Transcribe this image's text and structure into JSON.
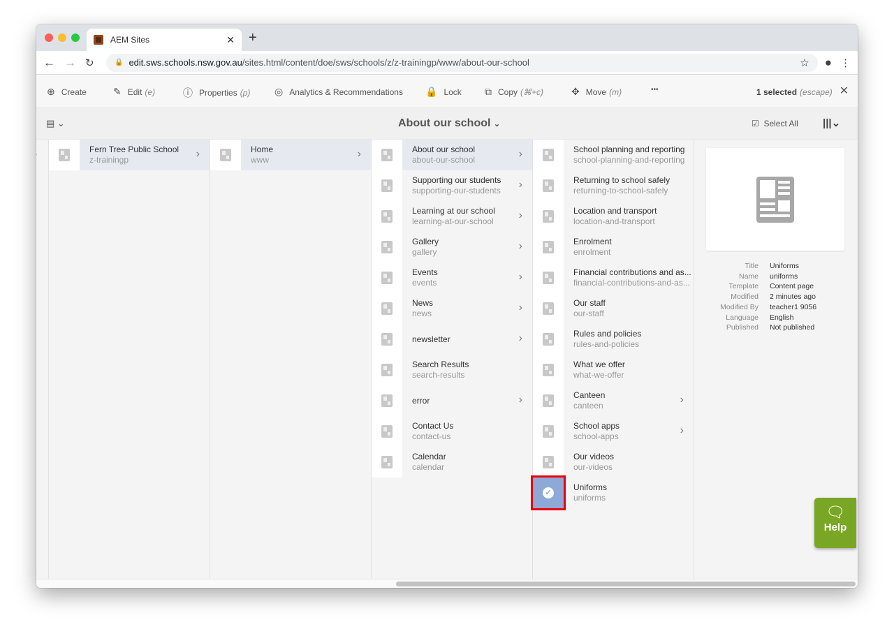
{
  "browser": {
    "tab_title": "AEM Sites",
    "url_host": "edit.sws.schools.nsw.gov.au",
    "url_path": "/sites.html/content/doe/sws/schools/z/z-trainingp/www/about-our-school"
  },
  "toolbar": {
    "create": "Create",
    "edit": "Edit",
    "edit_key": "(e)",
    "properties": "Properties",
    "properties_key": "(p)",
    "analytics": "Analytics & Recommendations",
    "lock": "Lock",
    "copy": "Copy",
    "copy_key": "(⌘+c)",
    "move": "Move",
    "move_key": "(m)",
    "more": "•••",
    "selected": "1 selected",
    "selected_key": "(escape)"
  },
  "header": {
    "title": "About our school",
    "select_all": "Select All"
  },
  "columns": [
    {
      "items": [
        {
          "title": "Fern Tree Public School",
          "name": "z-trainingp",
          "chevron": true,
          "active": true
        }
      ]
    },
    {
      "items": [
        {
          "title": "Home",
          "name": "www",
          "chevron": true,
          "active": true
        }
      ]
    },
    {
      "items": [
        {
          "title": "About our school",
          "name": "about-our-school",
          "chevron": true,
          "active": true
        },
        {
          "title": "Supporting our students",
          "name": "supporting-our-students",
          "chevron": true
        },
        {
          "title": "Learning at our school",
          "name": "learning-at-our-school",
          "chevron": true
        },
        {
          "title": "Gallery",
          "name": "gallery",
          "chevron": true
        },
        {
          "title": "Events",
          "name": "events",
          "chevron": true
        },
        {
          "title": "News",
          "name": "news",
          "chevron": true
        },
        {
          "title": "newsletter",
          "name": "",
          "chevron": true
        },
        {
          "title": "Search Results",
          "name": "search-results"
        },
        {
          "title": "error",
          "name": "",
          "chevron": true
        },
        {
          "title": "Contact Us",
          "name": "contact-us"
        },
        {
          "title": "Calendar",
          "name": "calendar"
        }
      ]
    },
    {
      "items": [
        {
          "title": "School planning and reporting",
          "name": "school-planning-and-reporting"
        },
        {
          "title": "Returning to school safely",
          "name": "returning-to-school-safely"
        },
        {
          "title": "Location and transport",
          "name": "location-and-transport"
        },
        {
          "title": "Enrolment",
          "name": "enrolment"
        },
        {
          "title": "Financial contributions and as...",
          "name": "financial-contributions-and-as..."
        },
        {
          "title": "Our staff",
          "name": "our-staff"
        },
        {
          "title": "Rules and policies",
          "name": "rules-and-policies"
        },
        {
          "title": "What we offer",
          "name": "what-we-offer"
        },
        {
          "title": "Canteen",
          "name": "canteen",
          "chevron": true
        },
        {
          "title": "School apps",
          "name": "school-apps",
          "chevron": true
        },
        {
          "title": "Our videos",
          "name": "our-videos"
        },
        {
          "title": "Uniforms",
          "name": "uniforms",
          "selected": true
        }
      ]
    }
  ],
  "preview": {
    "meta": [
      {
        "k": "Title",
        "v": "Uniforms"
      },
      {
        "k": "Name",
        "v": "uniforms"
      },
      {
        "k": "Template",
        "v": "Content page"
      },
      {
        "k": "Modified",
        "v": "2 minutes ago"
      },
      {
        "k": "Modified By",
        "v": "teacher1 9056"
      },
      {
        "k": "Language",
        "v": "English"
      },
      {
        "k": "Published",
        "v": "Not published"
      }
    ]
  },
  "help": {
    "label": "Help"
  },
  "colors": {
    "help": "#7aa626",
    "selection": "#8ea9d8",
    "highlight": "#e8000d"
  }
}
